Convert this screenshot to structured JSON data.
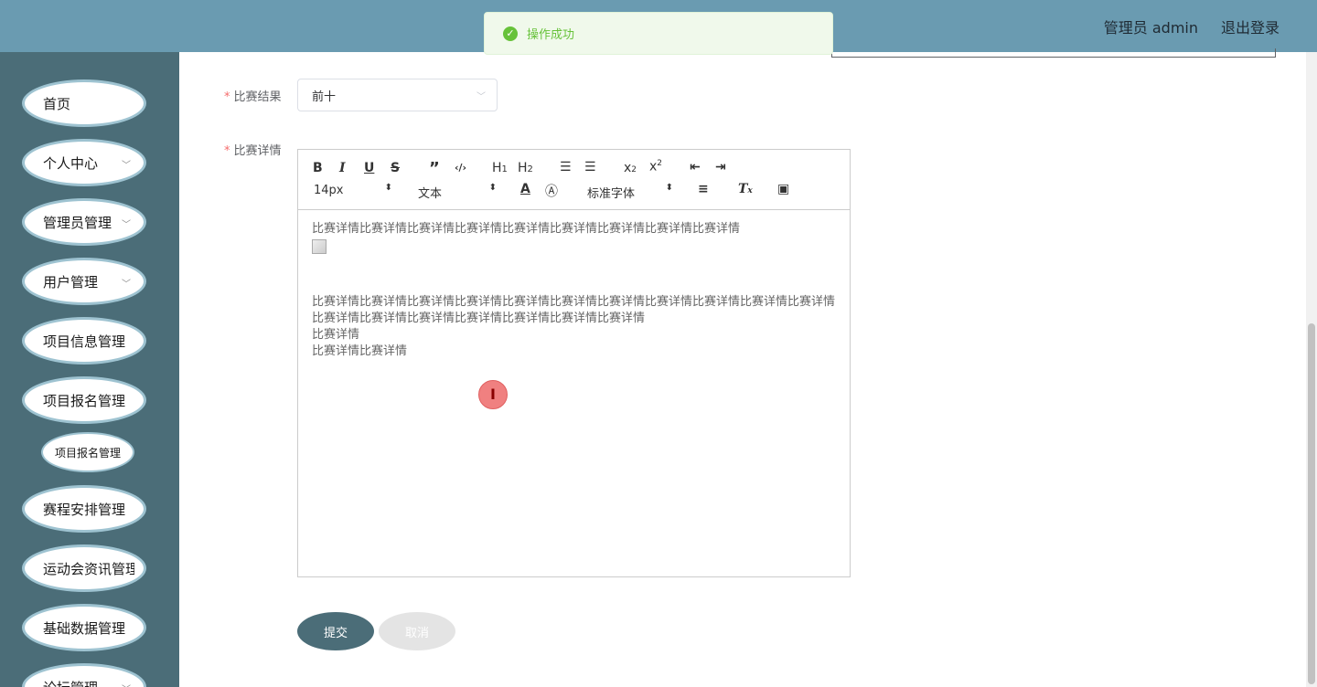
{
  "header": {
    "user_label": "管理员 admin",
    "logout_label": "退出登录"
  },
  "toast": {
    "message": "操作成功",
    "color": "#67c23a"
  },
  "sidebar": {
    "items": [
      {
        "label": "首页"
      },
      {
        "label": "个人中心"
      },
      {
        "label": "管理员管理"
      },
      {
        "label": "用户管理"
      },
      {
        "label": "项目信息管理"
      },
      {
        "label": "项目报名管理"
      },
      {
        "label": "赛程安排管理"
      },
      {
        "label": "运动会资讯管理"
      },
      {
        "label": "基础数据管理"
      },
      {
        "label": "论坛管理"
      }
    ],
    "sub_item": "项目报名管理"
  },
  "form": {
    "result_label": "比赛结果",
    "result_value": "前十",
    "detail_label": "比赛详情",
    "submit_label": "提交",
    "cancel_label": "取消"
  },
  "editor": {
    "font_size": "14px",
    "block_type": "文本",
    "font_family": "标准字体",
    "content": [
      "比赛详情比赛详情比赛详情比赛详情比赛详情比赛详情比赛详情比赛详情比赛详情",
      "比赛详情比赛详情比赛详情比赛详情比赛详情比赛详情比赛详情比赛详情比赛详情比赛详情比赛详情比赛详情比赛详情比赛详情比赛详情比赛详情比赛详情比赛详情",
      "比赛详情",
      "比赛详情比赛详情"
    ]
  },
  "colors": {
    "header": "#6a9bb1",
    "sidebar": "#4b6d78",
    "accent": "#4b6d78"
  }
}
